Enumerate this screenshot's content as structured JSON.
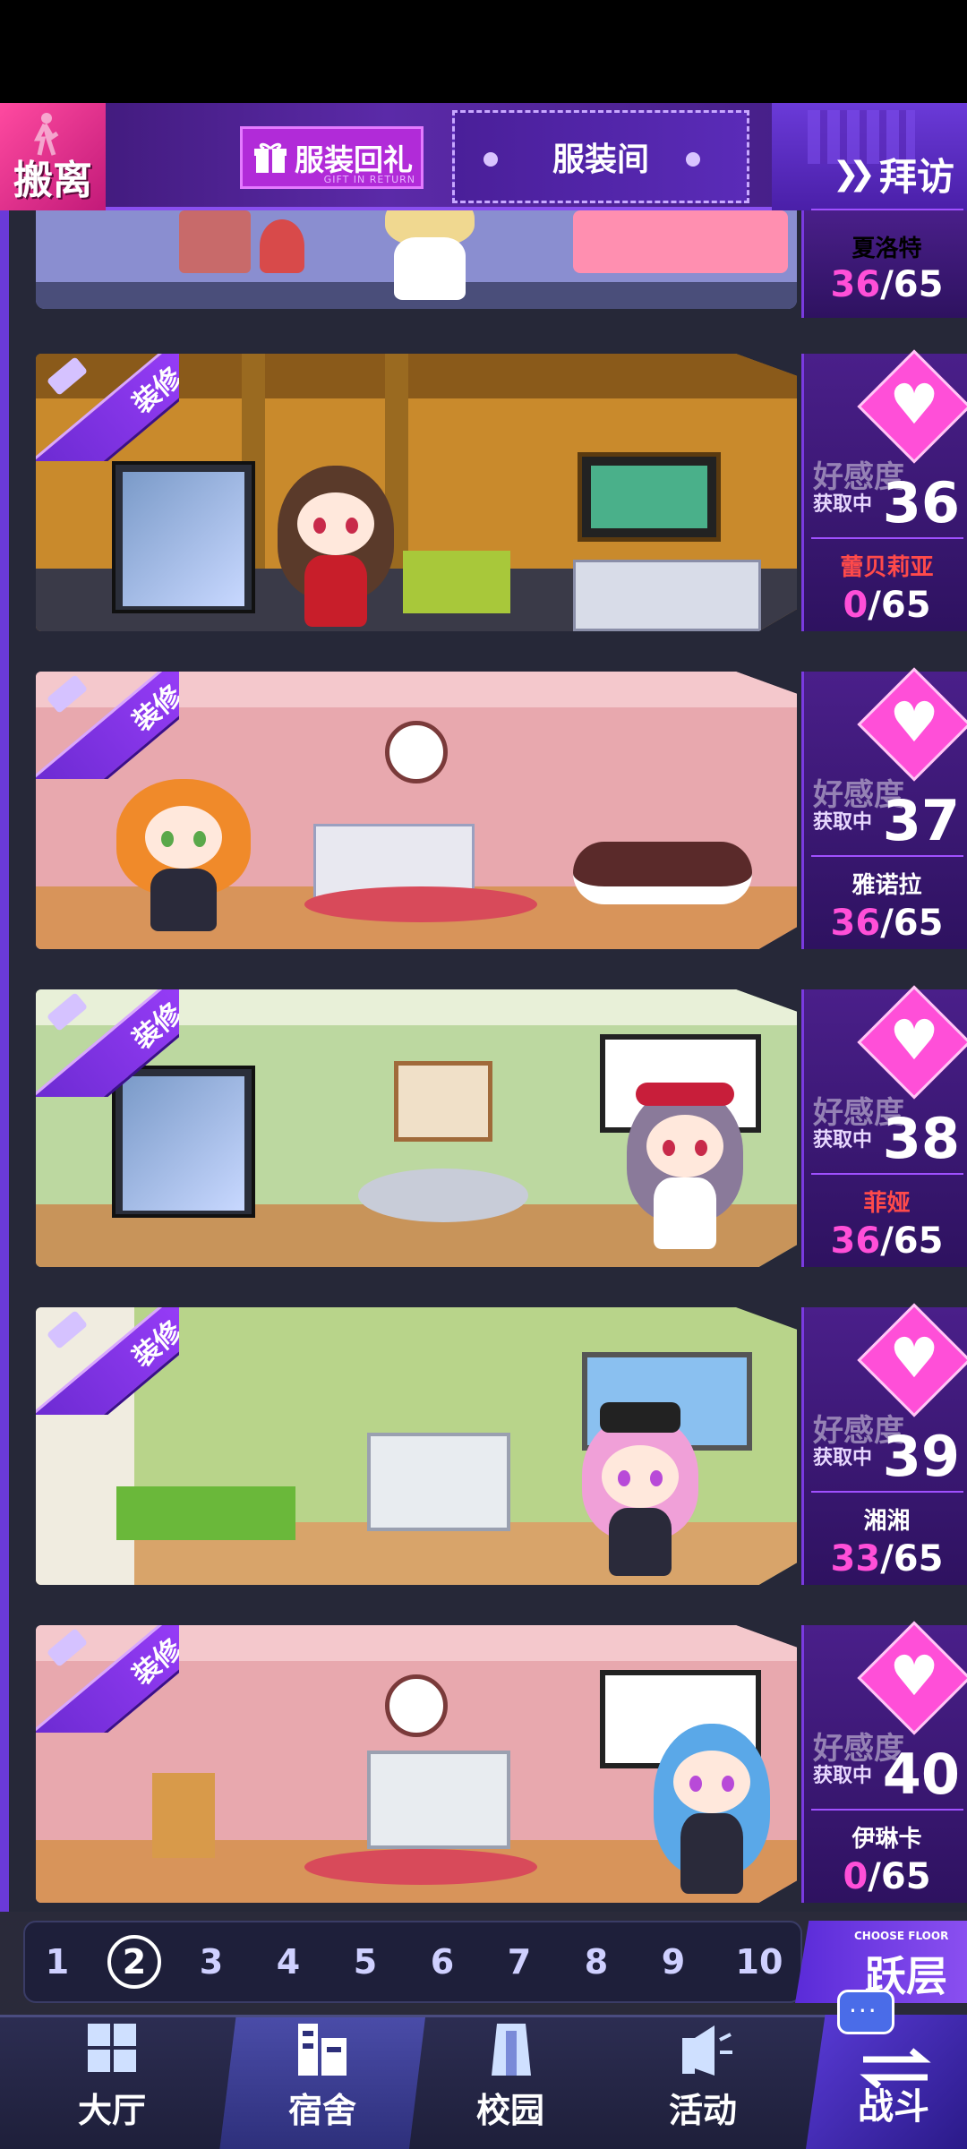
{
  "topbar": {
    "evacuate_label": "搬离",
    "gift_label": "服装回礼",
    "gift_sub": "GIFT IN RETURN",
    "wardrobe_label": "服装间",
    "visit_label": "拜访"
  },
  "rooms": [
    {
      "name": "夏洛特",
      "name_color": "#ff9a9a",
      "affection_current": "36",
      "affection_max": "65",
      "level": ""
    },
    {
      "name": "蕾贝莉亚",
      "name_color": "#ff4a4a",
      "affection_current": "0",
      "affection_max": "65",
      "level": "36",
      "affection_label": "好感度",
      "affection_sub": "获取中",
      "decorate_label": "装修"
    },
    {
      "name": "雅诺拉",
      "name_color": "#ffffff",
      "affection_current": "36",
      "affection_max": "65",
      "level": "37",
      "affection_label": "好感度",
      "affection_sub": "获取中",
      "decorate_label": "装修"
    },
    {
      "name": "菲娅",
      "name_color": "#ff4a4a",
      "affection_current": "36",
      "affection_max": "65",
      "level": "38",
      "affection_label": "好感度",
      "affection_sub": "获取中",
      "decorate_label": "装修"
    },
    {
      "name": "湘湘",
      "name_color": "#ffffff",
      "affection_current": "33",
      "affection_max": "65",
      "level": "39",
      "affection_label": "好感度",
      "affection_sub": "获取中",
      "decorate_label": "装修"
    },
    {
      "name": "伊琳卡",
      "name_color": "#ffffff",
      "affection_current": "0",
      "affection_max": "65",
      "level": "40",
      "affection_label": "好感度",
      "affection_sub": "获取中",
      "decorate_label": "装修"
    }
  ],
  "floor_selector": {
    "floors": [
      "1",
      "2",
      "3",
      "4",
      "5",
      "6",
      "7",
      "8",
      "9",
      "10"
    ],
    "active": "2",
    "choose_small": "CHOOSE FLOOR",
    "choose_big": "跃层"
  },
  "navbar": {
    "lobby": "大厅",
    "dorm": "宿舍",
    "campus": "校园",
    "events": "活动",
    "battle": "战斗",
    "chat_icon": "..."
  },
  "colors": {
    "accent": "#8a4ff0",
    "heart": "#ff4fd8",
    "panel": "#4a1f8a"
  }
}
